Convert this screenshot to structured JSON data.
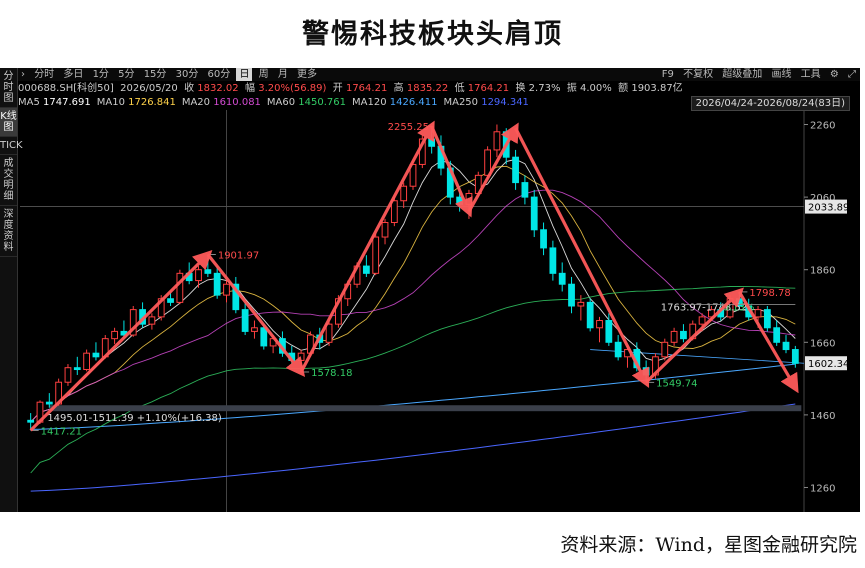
{
  "title": "警惕科技板块头肩顶",
  "source": "资料来源：Wind，星图金融研究院",
  "sidebar": [
    "分时图",
    "K线图",
    "TICK",
    "成交明细",
    "深度资料"
  ],
  "toolbar": {
    "periods": [
      "分时",
      "多日",
      "1分",
      "5分",
      "15分",
      "30分",
      "60分",
      "日",
      "周",
      "月",
      "更多"
    ],
    "selected": "日",
    "right_items": [
      "F9",
      "不复权",
      "超级叠加",
      "画线",
      "工具"
    ]
  },
  "info": {
    "code": "000688.SH[科创50]",
    "date": "2026/05/20",
    "close_label": "收",
    "close": "1832.02",
    "change_label": "幅",
    "change": "3.20%(56.89)",
    "open_label": "开",
    "open": "1764.21",
    "high_label": "高",
    "high": "1835.22",
    "low_label": "低",
    "low": "1764.21",
    "turnover_label": "换",
    "turnover": "2.73%",
    "amplitude_label": "振",
    "amplitude": "4.00%",
    "amount_label": "额",
    "amount": "1903.87亿"
  },
  "ma": [
    {
      "label": "MA5",
      "value": "1747.691",
      "color": "#ffffff"
    },
    {
      "label": "MA10",
      "value": "1726.841",
      "color": "#ffd24a"
    },
    {
      "label": "MA20",
      "value": "1610.081",
      "color": "#d24bd2"
    },
    {
      "label": "MA60",
      "value": "1450.761",
      "color": "#33cc66"
    },
    {
      "label": "MA120",
      "value": "1426.411",
      "color": "#4aa8ff"
    },
    {
      "label": "MA250",
      "value": "1294.341",
      "color": "#4a66ff"
    }
  ],
  "date_range": "2026/04/24-2026/08/24(83日)",
  "chart_data": {
    "type": "candlestick",
    "ylim": [
      1220,
      2300
    ],
    "yticks": [
      1260,
      1460,
      1660,
      1860,
      2060,
      2260
    ],
    "current_price": 1602.34,
    "crosshair_price": 2033.89,
    "support_band": [
      1495.01,
      1511.39
    ],
    "band_label": "1495.01-1511.39 +1.10%(+16.38)",
    "box_label": "1763.97-1748.52",
    "box_pct": "0.13%",
    "annotations": [
      {
        "text": "1417.21",
        "value": 1417.21,
        "color": "#33cc66"
      },
      {
        "text": "1901.97",
        "value": 1901.97,
        "color": "#ff4b4b"
      },
      {
        "text": "1578.18",
        "value": 1578.18,
        "color": "#33cc66"
      },
      {
        "text": "2255.25",
        "value": 2255.25,
        "color": "#ff4b4b"
      },
      {
        "text": "1549.74",
        "value": 1549.74,
        "color": "#33cc66"
      },
      {
        "text": "1798.78",
        "value": 1798.78,
        "color": "#ff4b4b"
      }
    ],
    "pattern_points": [
      {
        "index": 0,
        "value": 1417.21
      },
      {
        "index": 19,
        "value": 1901.97
      },
      {
        "index": 29,
        "value": 1578.18
      },
      {
        "index": 43,
        "value": 2255.25
      },
      {
        "index": 47,
        "value": 2020
      },
      {
        "index": 52,
        "value": 2250
      },
      {
        "index": 66,
        "value": 1549.74
      },
      {
        "index": 76,
        "value": 1798.78
      },
      {
        "index": 82,
        "value": 1535
      }
    ],
    "candles": [
      {
        "o": 1445,
        "h": 1465,
        "l": 1417,
        "c": 1440
      },
      {
        "o": 1440,
        "h": 1500,
        "l": 1435,
        "c": 1495
      },
      {
        "o": 1495,
        "h": 1520,
        "l": 1480,
        "c": 1490
      },
      {
        "o": 1490,
        "h": 1560,
        "l": 1485,
        "c": 1550
      },
      {
        "o": 1550,
        "h": 1600,
        "l": 1540,
        "c": 1590
      },
      {
        "o": 1590,
        "h": 1620,
        "l": 1570,
        "c": 1585
      },
      {
        "o": 1585,
        "h": 1640,
        "l": 1580,
        "c": 1630
      },
      {
        "o": 1630,
        "h": 1660,
        "l": 1610,
        "c": 1620
      },
      {
        "o": 1620,
        "h": 1680,
        "l": 1615,
        "c": 1670
      },
      {
        "o": 1670,
        "h": 1700,
        "l": 1655,
        "c": 1690
      },
      {
        "o": 1690,
        "h": 1720,
        "l": 1670,
        "c": 1680
      },
      {
        "o": 1680,
        "h": 1760,
        "l": 1675,
        "c": 1750
      },
      {
        "o": 1750,
        "h": 1770,
        "l": 1700,
        "c": 1710
      },
      {
        "o": 1710,
        "h": 1740,
        "l": 1695,
        "c": 1730
      },
      {
        "o": 1730,
        "h": 1790,
        "l": 1720,
        "c": 1780
      },
      {
        "o": 1780,
        "h": 1800,
        "l": 1760,
        "c": 1770
      },
      {
        "o": 1770,
        "h": 1860,
        "l": 1765,
        "c": 1850
      },
      {
        "o": 1850,
        "h": 1880,
        "l": 1820,
        "c": 1830
      },
      {
        "o": 1830,
        "h": 1870,
        "l": 1810,
        "c": 1860
      },
      {
        "o": 1860,
        "h": 1902,
        "l": 1840,
        "c": 1850
      },
      {
        "o": 1850,
        "h": 1870,
        "l": 1780,
        "c": 1790
      },
      {
        "o": 1790,
        "h": 1830,
        "l": 1770,
        "c": 1820
      },
      {
        "o": 1820,
        "h": 1840,
        "l": 1740,
        "c": 1750
      },
      {
        "o": 1750,
        "h": 1770,
        "l": 1680,
        "c": 1690
      },
      {
        "o": 1690,
        "h": 1720,
        "l": 1670,
        "c": 1700
      },
      {
        "o": 1700,
        "h": 1710,
        "l": 1640,
        "c": 1650
      },
      {
        "o": 1650,
        "h": 1680,
        "l": 1630,
        "c": 1670
      },
      {
        "o": 1670,
        "h": 1690,
        "l": 1620,
        "c": 1630
      },
      {
        "o": 1630,
        "h": 1650,
        "l": 1600,
        "c": 1610
      },
      {
        "o": 1610,
        "h": 1640,
        "l": 1578,
        "c": 1630
      },
      {
        "o": 1630,
        "h": 1690,
        "l": 1620,
        "c": 1680
      },
      {
        "o": 1680,
        "h": 1700,
        "l": 1640,
        "c": 1660
      },
      {
        "o": 1660,
        "h": 1720,
        "l": 1650,
        "c": 1710
      },
      {
        "o": 1710,
        "h": 1790,
        "l": 1700,
        "c": 1780
      },
      {
        "o": 1780,
        "h": 1830,
        "l": 1760,
        "c": 1820
      },
      {
        "o": 1820,
        "h": 1880,
        "l": 1810,
        "c": 1870
      },
      {
        "o": 1870,
        "h": 1900,
        "l": 1840,
        "c": 1850
      },
      {
        "o": 1850,
        "h": 1960,
        "l": 1845,
        "c": 1950
      },
      {
        "o": 1950,
        "h": 2000,
        "l": 1930,
        "c": 1990
      },
      {
        "o": 1990,
        "h": 2060,
        "l": 1980,
        "c": 2050
      },
      {
        "o": 2050,
        "h": 2100,
        "l": 2030,
        "c": 2090
      },
      {
        "o": 2090,
        "h": 2160,
        "l": 2080,
        "c": 2150
      },
      {
        "o": 2150,
        "h": 2230,
        "l": 2140,
        "c": 2220
      },
      {
        "o": 2220,
        "h": 2255,
        "l": 2180,
        "c": 2200
      },
      {
        "o": 2200,
        "h": 2230,
        "l": 2120,
        "c": 2140
      },
      {
        "o": 2140,
        "h": 2160,
        "l": 2040,
        "c": 2060
      },
      {
        "o": 2060,
        "h": 2090,
        "l": 2020,
        "c": 2040
      },
      {
        "o": 2040,
        "h": 2080,
        "l": 2000,
        "c": 2070
      },
      {
        "o": 2070,
        "h": 2130,
        "l": 2060,
        "c": 2120
      },
      {
        "o": 2120,
        "h": 2200,
        "l": 2110,
        "c": 2190
      },
      {
        "o": 2190,
        "h": 2260,
        "l": 2170,
        "c": 2240
      },
      {
        "o": 2240,
        "h": 2250,
        "l": 2150,
        "c": 2170
      },
      {
        "o": 2170,
        "h": 2190,
        "l": 2080,
        "c": 2100
      },
      {
        "o": 2100,
        "h": 2120,
        "l": 2040,
        "c": 2060
      },
      {
        "o": 2060,
        "h": 2080,
        "l": 1950,
        "c": 1970
      },
      {
        "o": 1970,
        "h": 1990,
        "l": 1900,
        "c": 1920
      },
      {
        "o": 1920,
        "h": 1940,
        "l": 1830,
        "c": 1850
      },
      {
        "o": 1850,
        "h": 1880,
        "l": 1800,
        "c": 1820
      },
      {
        "o": 1820,
        "h": 1840,
        "l": 1740,
        "c": 1760
      },
      {
        "o": 1760,
        "h": 1790,
        "l": 1720,
        "c": 1770
      },
      {
        "o": 1770,
        "h": 1780,
        "l": 1690,
        "c": 1700
      },
      {
        "o": 1700,
        "h": 1730,
        "l": 1660,
        "c": 1720
      },
      {
        "o": 1720,
        "h": 1740,
        "l": 1650,
        "c": 1660
      },
      {
        "o": 1660,
        "h": 1680,
        "l": 1610,
        "c": 1620
      },
      {
        "o": 1620,
        "h": 1650,
        "l": 1590,
        "c": 1640
      },
      {
        "o": 1640,
        "h": 1660,
        "l": 1580,
        "c": 1590
      },
      {
        "o": 1590,
        "h": 1610,
        "l": 1550,
        "c": 1570
      },
      {
        "o": 1570,
        "h": 1630,
        "l": 1560,
        "c": 1620
      },
      {
        "o": 1620,
        "h": 1670,
        "l": 1610,
        "c": 1660
      },
      {
        "o": 1660,
        "h": 1700,
        "l": 1650,
        "c": 1690
      },
      {
        "o": 1690,
        "h": 1710,
        "l": 1660,
        "c": 1670
      },
      {
        "o": 1670,
        "h": 1720,
        "l": 1665,
        "c": 1710
      },
      {
        "o": 1710,
        "h": 1740,
        "l": 1690,
        "c": 1730
      },
      {
        "o": 1730,
        "h": 1760,
        "l": 1720,
        "c": 1750
      },
      {
        "o": 1750,
        "h": 1770,
        "l": 1720,
        "c": 1730
      },
      {
        "o": 1730,
        "h": 1790,
        "l": 1725,
        "c": 1780
      },
      {
        "o": 1780,
        "h": 1799,
        "l": 1750,
        "c": 1760
      },
      {
        "o": 1760,
        "h": 1780,
        "l": 1720,
        "c": 1730
      },
      {
        "o": 1730,
        "h": 1760,
        "l": 1700,
        "c": 1750
      },
      {
        "o": 1750,
        "h": 1760,
        "l": 1690,
        "c": 1700
      },
      {
        "o": 1700,
        "h": 1720,
        "l": 1650,
        "c": 1660
      },
      {
        "o": 1660,
        "h": 1680,
        "l": 1630,
        "c": 1640
      },
      {
        "o": 1640,
        "h": 1650,
        "l": 1590,
        "c": 1602
      }
    ],
    "ma_lines": [
      {
        "name": "MA120",
        "color": "#4aa8ff",
        "from": 1420,
        "to": 1600
      },
      {
        "name": "MA250",
        "color": "#4a66ff",
        "from": 1250,
        "to": 1490
      }
    ]
  }
}
